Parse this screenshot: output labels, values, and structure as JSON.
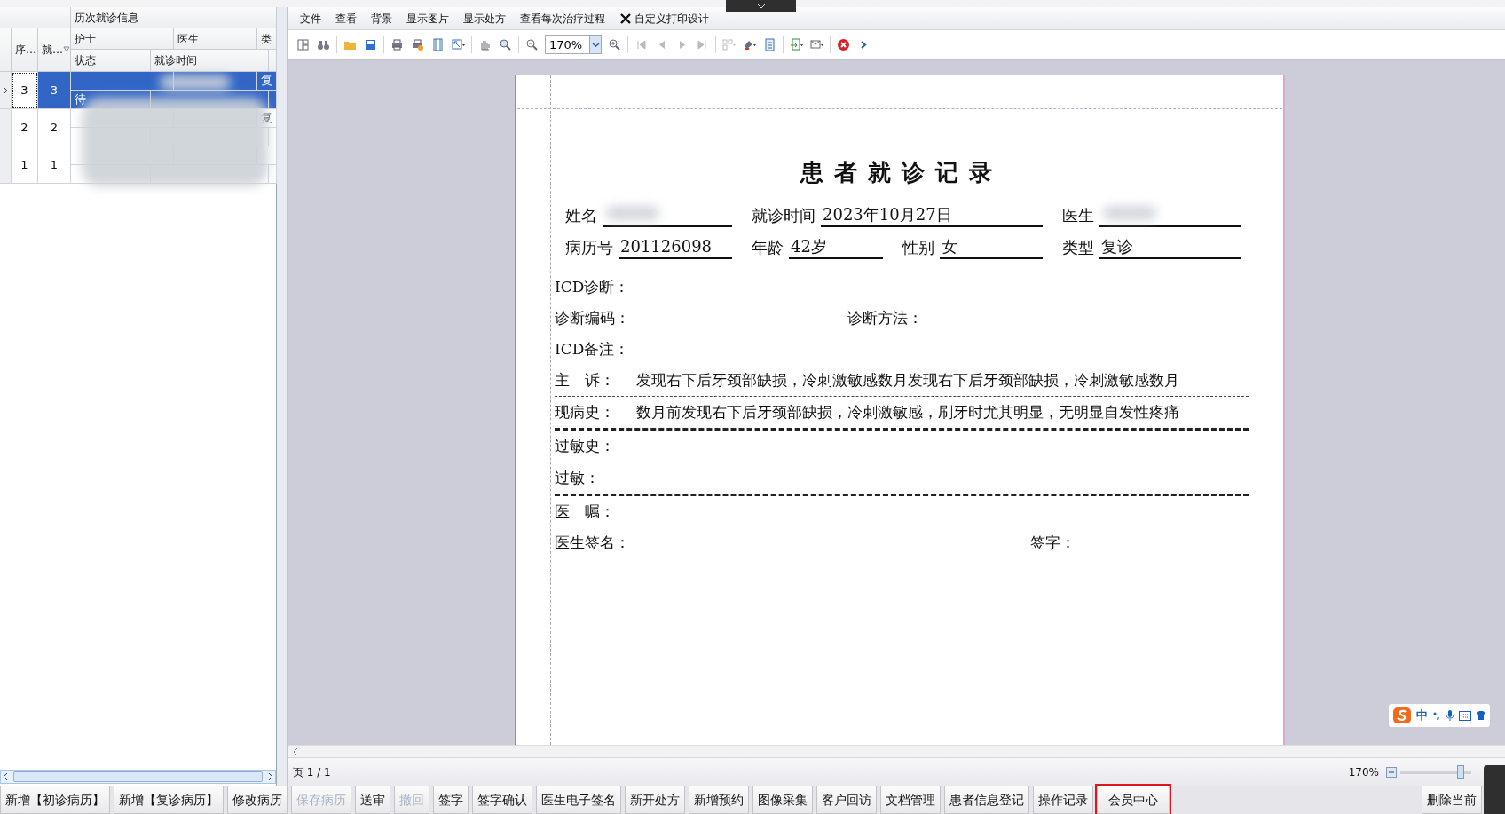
{
  "grid": {
    "group_title": "历次就诊信息",
    "col_no": "序…",
    "col_visit": "就…",
    "col_nurse": "护士",
    "col_doctor": "医生",
    "col_type": "类",
    "col_status": "状态",
    "col_time": "就诊时间",
    "rows": [
      {
        "no": "3",
        "visit": "3",
        "type": "复",
        "status": "待",
        "selected": true
      },
      {
        "no": "2",
        "visit": "2",
        "type": "复",
        "status": "",
        "selected": false
      },
      {
        "no": "1",
        "visit": "1",
        "type": "",
        "status": "",
        "selected": false
      }
    ]
  },
  "menu": [
    {
      "label": "文件",
      "kind": "plain"
    },
    {
      "label": "查看",
      "kind": "plain"
    },
    {
      "label": "背景",
      "kind": "plain"
    },
    {
      "label": "显示图片",
      "kind": "plain"
    },
    {
      "label": "显示处方",
      "kind": "plain"
    },
    {
      "label": "查看每次治疗过程",
      "kind": "plain"
    },
    {
      "label": "自定义打印设计",
      "kind": "tools"
    }
  ],
  "toolbar": [
    {
      "kind": "layout",
      "disabled": false
    },
    {
      "kind": "binoculars",
      "disabled": false
    },
    {
      "kind": "sep"
    },
    {
      "kind": "folder",
      "disabled": false
    },
    {
      "kind": "save",
      "disabled": false
    },
    {
      "kind": "sep"
    },
    {
      "kind": "print",
      "disabled": false
    },
    {
      "kind": "print-options",
      "disabled": false
    },
    {
      "kind": "page",
      "disabled": false
    },
    {
      "kind": "fit",
      "disabled": false
    },
    {
      "kind": "sep"
    },
    {
      "kind": "hand",
      "disabled": false
    },
    {
      "kind": "zoom-area",
      "disabled": false
    },
    {
      "kind": "sep"
    },
    {
      "kind": "zoom-out",
      "disabled": false
    },
    {
      "kind": "zoom",
      "value": "170%"
    },
    {
      "kind": "zoom-in",
      "disabled": false
    },
    {
      "kind": "sep"
    },
    {
      "kind": "first",
      "disabled": true
    },
    {
      "kind": "prev",
      "disabled": true
    },
    {
      "kind": "next",
      "disabled": true
    },
    {
      "kind": "last",
      "disabled": true
    },
    {
      "kind": "sep"
    },
    {
      "kind": "multipage",
      "disabled": true
    },
    {
      "kind": "color",
      "disabled": false
    },
    {
      "kind": "document",
      "disabled": false
    },
    {
      "kind": "sep"
    },
    {
      "kind": "export",
      "disabled": false
    },
    {
      "kind": "mail",
      "disabled": false
    },
    {
      "kind": "sep"
    },
    {
      "kind": "close",
      "disabled": false
    },
    {
      "kind": "more",
      "disabled": false
    }
  ],
  "record": {
    "title": "患者就诊记录",
    "header_fields": [
      [
        {
          "label": "姓名",
          "redacted": true
        },
        {
          "label": "就诊时间",
          "value": "2023年10月27日"
        },
        {
          "label": "医生",
          "redacted": true
        }
      ],
      [
        {
          "label": "病历号",
          "value": "201126098"
        },
        {
          "label": "年龄",
          "value": "42岁"
        },
        {
          "label": "性别",
          "value": "女"
        },
        {
          "label": "类型",
          "value": "复诊"
        }
      ]
    ],
    "lines": [
      {
        "kind": "single",
        "label": "ICD诊断：",
        "rule": false
      },
      {
        "kind": "pair",
        "label": "诊断编码：",
        "label2": "诊断方法：",
        "rule": false
      },
      {
        "kind": "single",
        "label": "ICD备注：",
        "rule": false
      },
      {
        "kind": "text",
        "label": "主　诉：",
        "value": "发现右下后牙颈部缺损，冷刺激敏感数月发现右下后牙颈部缺损，冷刺激敏感数月",
        "rule": true,
        "rule_bold": false
      },
      {
        "kind": "text",
        "label": "现病史：",
        "value": "数月前发现右下后牙颈部缺损，冷刺激敏感，刷牙时尤其明显，无明显自发性疼痛",
        "rule": true,
        "rule_bold": true
      },
      {
        "kind": "single",
        "label": "过敏史：",
        "rule": true,
        "rule_bold": false
      },
      {
        "kind": "single",
        "label": "过敏：",
        "rule": true,
        "rule_bold": true
      },
      {
        "kind": "single",
        "label": "医　嘱：",
        "rule": false
      },
      {
        "kind": "signature",
        "label": "医生签名：",
        "label2": "签字：",
        "rule": false
      }
    ]
  },
  "status_bar": {
    "page": "页 1 / 1",
    "zoom": "170%",
    "level": 0.85
  },
  "ime": {
    "label": "中"
  },
  "buttons": [
    {
      "label": "新增【初诊病历】",
      "disabled": false,
      "highlighted": false
    },
    {
      "label": "新增【复诊病历】",
      "disabled": false,
      "highlighted": false
    },
    {
      "label": "修改病历",
      "disabled": false,
      "highlighted": false
    },
    {
      "label": "保存病历",
      "disabled": true,
      "highlighted": false
    },
    {
      "label": "送审",
      "disabled": false,
      "highlighted": false
    },
    {
      "label": "撤回",
      "disabled": true,
      "highlighted": false
    },
    {
      "label": "签字",
      "disabled": false,
      "highlighted": false
    },
    {
      "label": "签字确认",
      "disabled": false,
      "highlighted": false
    },
    {
      "label": "医生电子签名",
      "disabled": false,
      "highlighted": false
    },
    {
      "label": "新开处方",
      "disabled": false,
      "highlighted": false
    },
    {
      "label": "新增预约",
      "disabled": false,
      "highlighted": false
    },
    {
      "label": "图像采集",
      "disabled": false,
      "highlighted": false
    },
    {
      "label": "客户回访",
      "disabled": false,
      "highlighted": false
    },
    {
      "label": "文档管理",
      "disabled": false,
      "highlighted": false
    },
    {
      "label": "患者信息登记",
      "disabled": false,
      "highlighted": false
    },
    {
      "label": "操作记录",
      "disabled": false,
      "highlighted": false
    },
    {
      "label": "会员中心",
      "disabled": false,
      "highlighted": true
    }
  ],
  "right_button": {
    "label": "删除当前"
  }
}
